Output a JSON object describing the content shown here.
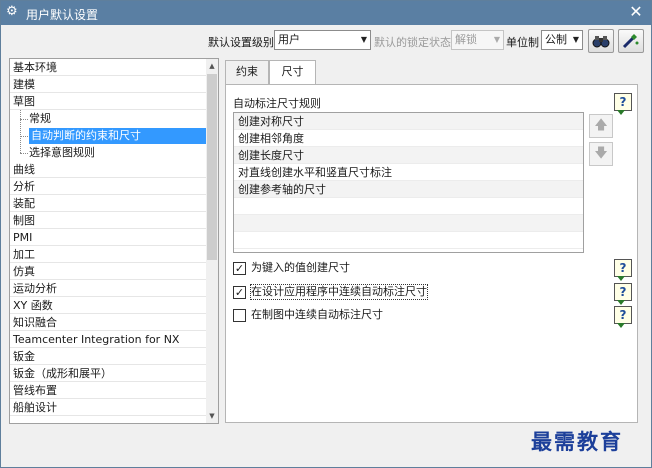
{
  "window": {
    "title": "用户默认设置",
    "close_label": "✕"
  },
  "toolbar": {
    "level_label": "默认设置级别",
    "level_value": "用户",
    "lock_label": "默认的锁定状态",
    "lock_value": "解锁",
    "unit_label": "单位制",
    "unit_value": "公制"
  },
  "tree": {
    "items": [
      {
        "label": "基本环境"
      },
      {
        "label": "建模"
      },
      {
        "label": "草图"
      },
      {
        "label": "常规"
      },
      {
        "label": "自动判断的约束和尺寸"
      },
      {
        "label": "选择意图规则"
      },
      {
        "label": "曲线"
      },
      {
        "label": "分析"
      },
      {
        "label": "装配"
      },
      {
        "label": "制图"
      },
      {
        "label": "PMI"
      },
      {
        "label": "加工"
      },
      {
        "label": "仿真"
      },
      {
        "label": "运动分析"
      },
      {
        "label": "XY 函数"
      },
      {
        "label": "知识融合"
      },
      {
        "label": "Teamcenter Integration for NX"
      },
      {
        "label": "钣金"
      },
      {
        "label": "钣金（成形和展平）"
      },
      {
        "label": "管线布置"
      },
      {
        "label": "船舶设计"
      }
    ]
  },
  "tabs": [
    {
      "label": "约束"
    },
    {
      "label": "尺寸"
    }
  ],
  "panel": {
    "section_title": "自动标注尺寸规则",
    "rules": [
      "创建对称尺寸",
      "创建相邻角度",
      "创建长度尺寸",
      "对直线创建水平和竖直尺寸标注",
      "创建参考轴的尺寸"
    ],
    "move_up": "🡅",
    "move_down": "🡇",
    "checkboxes": [
      {
        "label": "为键入的值创建尺寸",
        "checked": true
      },
      {
        "label": "在设计应用程序中连续自动标注尺寸",
        "checked": true
      },
      {
        "label": "在制图中连续自动标注尺寸",
        "checked": false
      }
    ],
    "help_glyph": "?"
  },
  "icons": {
    "settings": "⚙",
    "check": "✓"
  },
  "watermark": "最需教育",
  "colors": {
    "titlebar": "#5a7fa3",
    "selection": "#3399ff",
    "watermark": "#1c3f9a"
  }
}
